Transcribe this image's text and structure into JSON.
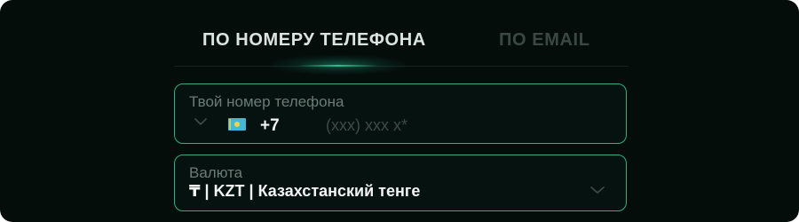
{
  "tabs": {
    "phone_label": "ПО НОМЕРУ ТЕЛЕФОНА",
    "email_label": "ПО EMAIL",
    "active": "phone"
  },
  "phone_field": {
    "label": "Твой номер телефона",
    "country_flag": "kazakhstan-flag-icon",
    "dial_code": "+7",
    "value": "",
    "placeholder": "(xxx) xxx x*"
  },
  "currency_field": {
    "label": "Валюта",
    "selected": "₸ | KZT | Казахстанский тенге"
  },
  "colors": {
    "background": "#050d0b",
    "accent": "#2fae84",
    "active_tab_text": "#dde3e0",
    "inactive_tab_text": "#3a4743",
    "label_text": "#6c7b76"
  }
}
